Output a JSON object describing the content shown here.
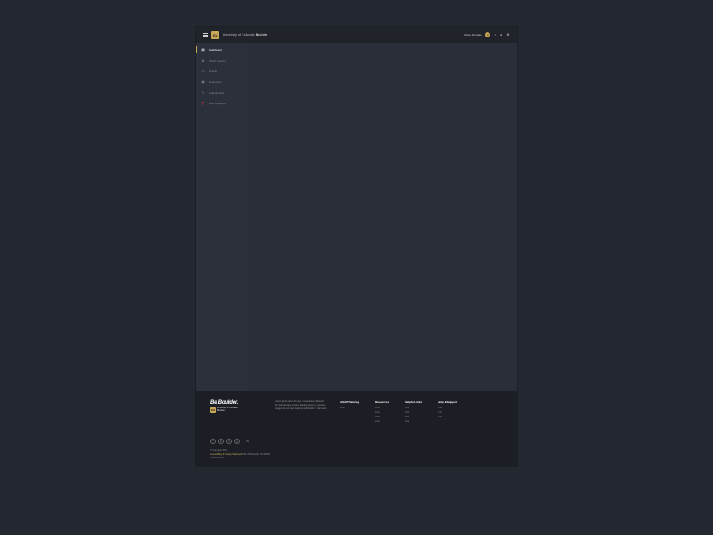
{
  "header": {
    "logo_text": "CU",
    "title_a": "University of Colorado ",
    "title_b": "Boulder",
    "user_name": "Diana Donado",
    "avatar_initial": "D"
  },
  "sidebar": [
    {
      "label": "Dashboard",
      "icon": "▤",
      "active": true,
      "expand": false
    },
    {
      "label": "ASAP Tutoring",
      "icon": "✿",
      "active": false,
      "expand": false
    },
    {
      "label": "Results",
      "icon": "▭",
      "active": false,
      "expand": false
    },
    {
      "label": "Resources",
      "icon": "▣",
      "active": false,
      "expand": true
    },
    {
      "label": "Helpful Links",
      "icon": "✎",
      "active": false,
      "expand": true
    },
    {
      "label": "Help & Support",
      "icon": "❓",
      "active": false,
      "expand": false
    }
  ],
  "footer": {
    "be_boulder": "Be Boulder.",
    "logo_text": "CU",
    "logo_sub_a": "University of Colorado",
    "logo_sub_b": "Boulder",
    "desc": "Lorem ipsum dolor sit amet, consectetur adipiscing elit. Pellentesque pretium dapibus ipsum eu pretium. Integer nisl est maxi dapibus sollicitudin in, nisi tortor.",
    "columns": [
      {
        "title": "ASAP Tutoring",
        "links": [
          "Link"
        ]
      },
      {
        "title": "Resources",
        "links": [
          "Link",
          "Link",
          "Link",
          "Link"
        ]
      },
      {
        "title": "Helpful Links",
        "links": [
          "Link",
          "Link",
          "Link",
          "Link"
        ]
      },
      {
        "title": "Help & Support",
        "links": [
          "Link",
          "Link",
          "Link"
        ]
      }
    ],
    "legal_copy": "© Copyright 2019",
    "legal_gold": "Accessibility & Privacy Statement",
    "legal_addr": " 135 UCB Boulder, CO 80309",
    "legal_phone": "303-492-6611"
  }
}
